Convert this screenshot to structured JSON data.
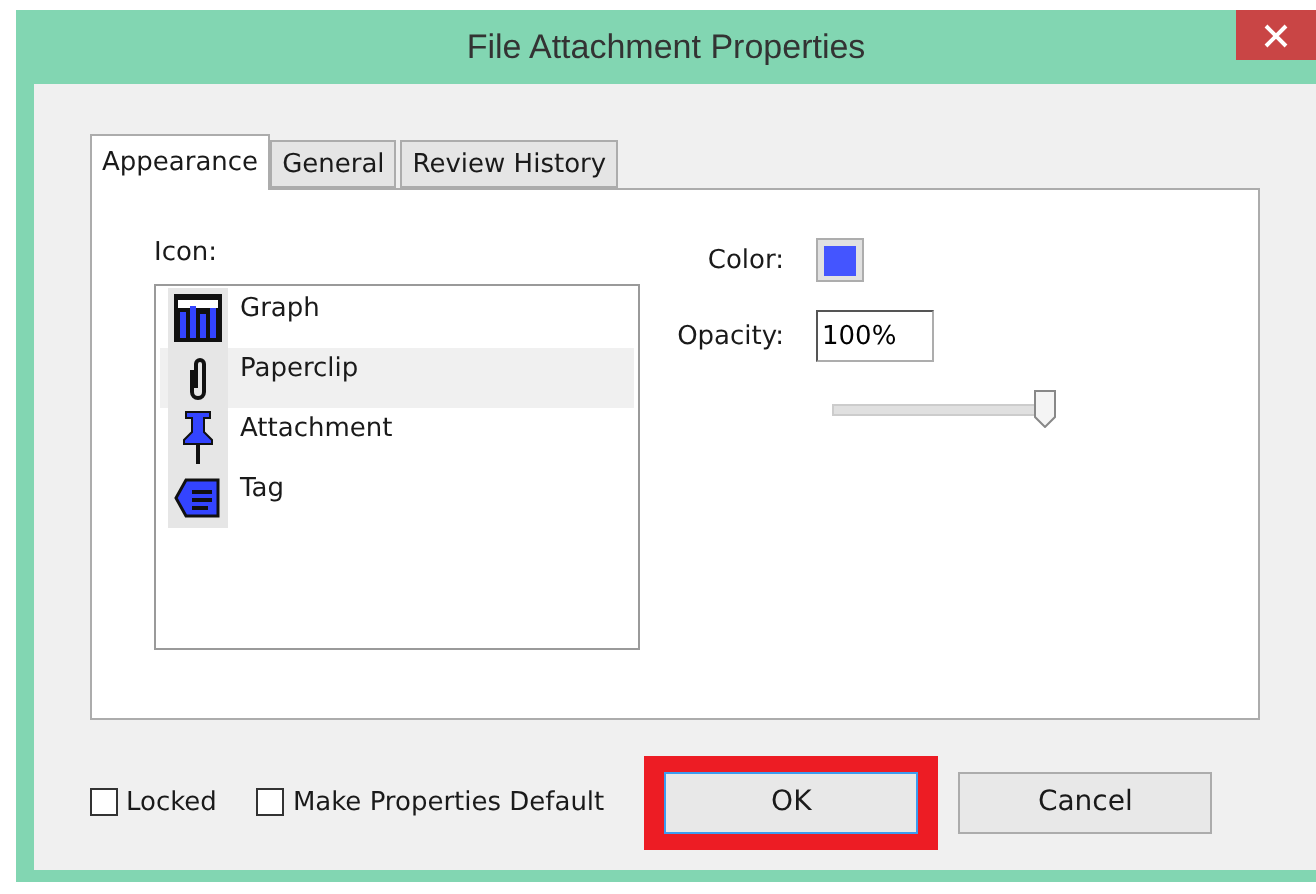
{
  "window": {
    "title": "File Attachment Properties"
  },
  "tabs": [
    {
      "label": "Appearance",
      "selected": true
    },
    {
      "label": "General",
      "selected": false
    },
    {
      "label": "Review History",
      "selected": false
    }
  ],
  "icon_list": {
    "label": "Icon:",
    "items": [
      {
        "kind": "graph",
        "label": "Graph",
        "selected": false
      },
      {
        "kind": "paperclip",
        "label": "Paperclip",
        "selected": true
      },
      {
        "kind": "pushpin",
        "label": "Attachment",
        "selected": false
      },
      {
        "kind": "tag",
        "label": "Tag",
        "selected": false
      }
    ]
  },
  "color": {
    "label": "Color:",
    "color": "#4455ff"
  },
  "opacity": {
    "label": "Opacity:",
    "value": "100%",
    "level": 1
  },
  "checkboxes": [
    {
      "label": "Locked",
      "checked": false
    },
    {
      "label": "Make Properties Default",
      "checked": false
    }
  ],
  "buttons": [
    {
      "label": "OK",
      "highlighted": true,
      "focused": true
    },
    {
      "label": "Cancel",
      "highlighted": false,
      "focused": false
    }
  ]
}
